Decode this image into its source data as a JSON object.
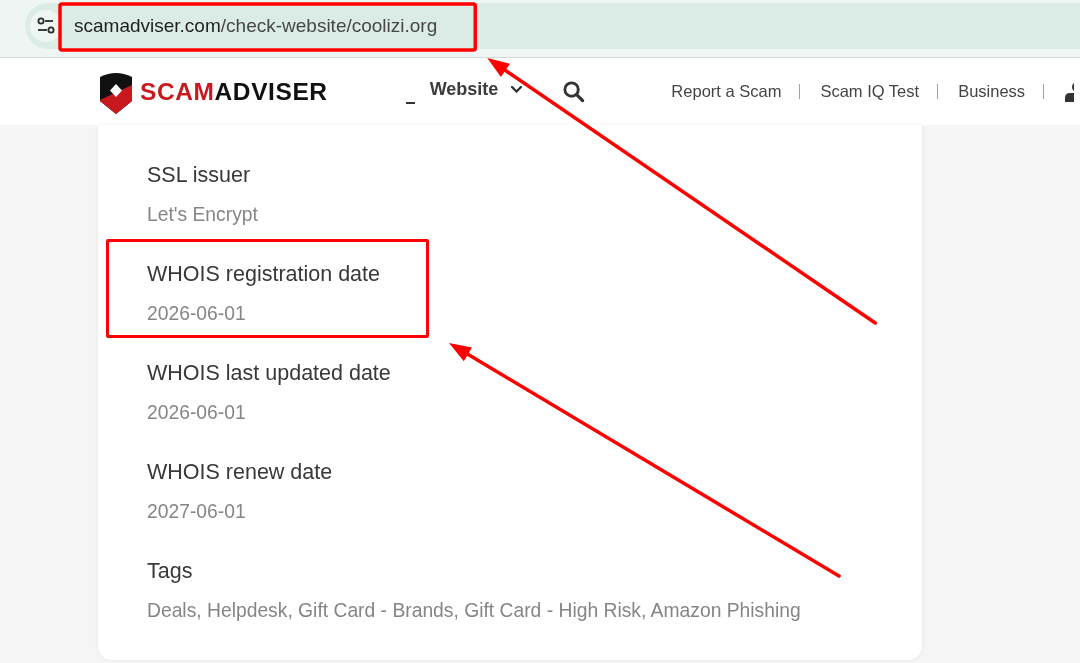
{
  "browser": {
    "url_host": "scamadviser.com",
    "url_path": "/check-website/coolizi.org",
    "highlighted": true
  },
  "header": {
    "logo": {
      "part_1": "SCAM",
      "part_2": "ADVISER"
    },
    "menu": {
      "label": "Website"
    },
    "links": [
      {
        "label": "Report a Scam"
      },
      {
        "label": "Scam IQ Test"
      },
      {
        "label": "Business"
      }
    ]
  },
  "fields": [
    {
      "label": "SSL issuer",
      "value": "Let's Encrypt",
      "highlighted": false
    },
    {
      "label": "WHOIS registration date",
      "value": "2026-06-01",
      "highlighted": true
    },
    {
      "label": "WHOIS last updated date",
      "value": "2026-06-01",
      "highlighted": false
    },
    {
      "label": "WHOIS renew date",
      "value": "2027-06-01",
      "highlighted": false
    },
    {
      "label": "Tags",
      "value": "Deals, Helpdesk, Gift Card - Brands, Gift Card - High Risk, Amazon Phishing",
      "highlighted": false
    }
  ]
}
